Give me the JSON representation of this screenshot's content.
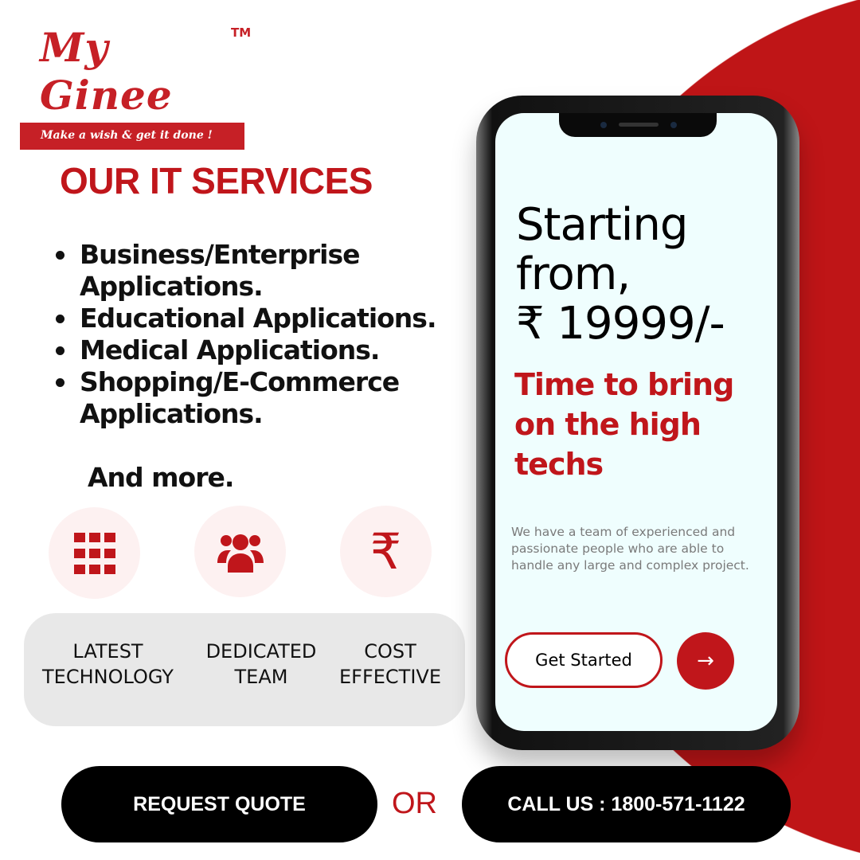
{
  "brand": {
    "name": "My Ginee",
    "tm": "TM",
    "tagline": "Make a wish & get it done !",
    "accent": "#bf1517"
  },
  "heading": "OUR IT SERVICES",
  "services": [
    "Business/Enterprise Applications.",
    "Educational Applications.",
    "Medical Applications.",
    "Shopping/E-Commerce Applications."
  ],
  "more": "And more.",
  "features": [
    {
      "icon": "grid-icon",
      "line1": "LATEST",
      "line2": "TECHNOLOGY"
    },
    {
      "icon": "team-icon",
      "line1": "DEDICATED",
      "line2": "TEAM"
    },
    {
      "icon": "rupee-icon",
      "line1": "COST",
      "line2": "EFFECTIVE",
      "glyph": "₹"
    }
  ],
  "phone": {
    "line1": "Starting",
    "line2": "from,",
    "price": "₹ 19999/-",
    "subheading": "Time to bring on the high techs",
    "description": "We have a team of experienced and passionate people who are able to handle any large and complex project.",
    "cta": "Get Started",
    "arrow": "→"
  },
  "actions": {
    "quote": "REQUEST QUOTE",
    "or": "OR",
    "call": "CALL US : 1800-571-1122"
  }
}
